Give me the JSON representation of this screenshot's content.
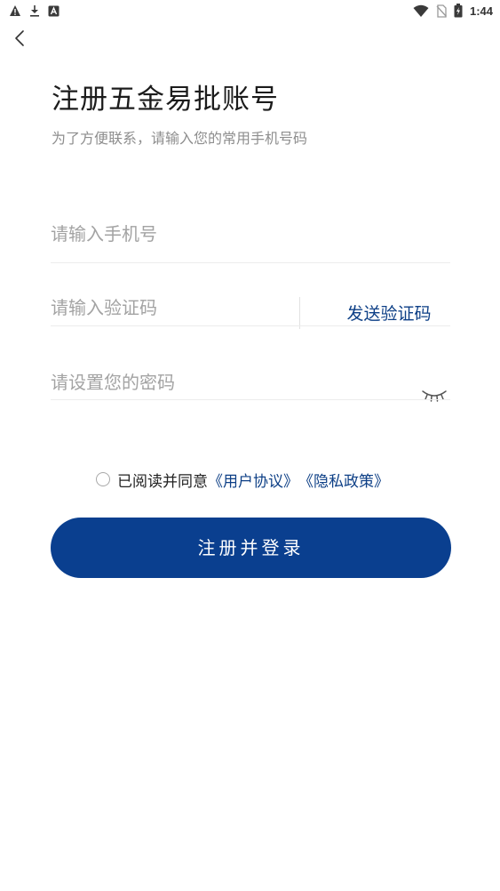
{
  "status_bar": {
    "time": "1:44",
    "left_icons": [
      "warning-icon",
      "download-icon",
      "a-icon"
    ],
    "right_icons": [
      "wifi-icon",
      "no-sim-icon",
      "battery-icon"
    ]
  },
  "header": {
    "back_icon": "chevron-left-icon",
    "title": "注册五金易批账号",
    "subtitle": "为了方便联系，请输入您的常用手机号码"
  },
  "form": {
    "phone_placeholder": "请输入手机号",
    "phone_value": "",
    "code_placeholder": "请输入验证码",
    "code_value": "",
    "send_code_label": "发送验证码",
    "password_placeholder": "请设置您的密码",
    "password_value": "",
    "password_toggle_icon": "eye-closed-icon"
  },
  "agreement": {
    "checked": false,
    "prefix": "已阅读并同意",
    "user_agreement": "《用户协议》",
    "privacy_policy": "《隐私政策》"
  },
  "actions": {
    "register_label": "注册并登录"
  },
  "colors": {
    "primary": "#0a3f8f",
    "link": "#0d3f86",
    "placeholder": "#a3a3a3",
    "subtitle": "#8e8e8e"
  }
}
